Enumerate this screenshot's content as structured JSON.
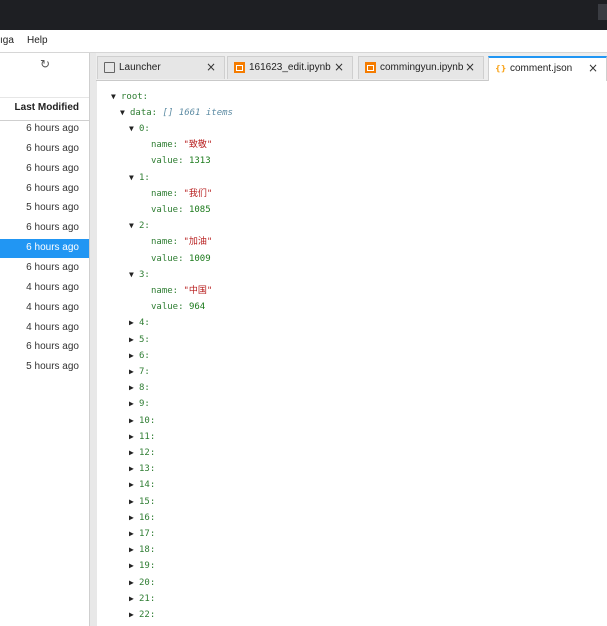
{
  "menu": {
    "items": [
      "ıga",
      "Help"
    ]
  },
  "file_browser": {
    "column_header": "Last Modified",
    "rows": [
      {
        "modified": "6 hours ago",
        "selected": false
      },
      {
        "modified": "6 hours ago",
        "selected": false
      },
      {
        "modified": "6 hours ago",
        "selected": false
      },
      {
        "modified": "6 hours ago",
        "selected": false
      },
      {
        "modified": "5 hours ago",
        "selected": false
      },
      {
        "modified": "6 hours ago",
        "selected": false
      },
      {
        "modified": "6 hours ago",
        "selected": true
      },
      {
        "modified": "6 hours ago",
        "selected": false
      },
      {
        "modified": "4 hours ago",
        "selected": false
      },
      {
        "modified": "4 hours ago",
        "selected": false
      },
      {
        "modified": "4 hours ago",
        "selected": false
      },
      {
        "modified": "6 hours ago",
        "selected": false
      },
      {
        "modified": "5 hours ago",
        "selected": false
      }
    ]
  },
  "tabs": [
    {
      "label": "Launcher",
      "icon": "launcher-icon",
      "active": false
    },
    {
      "label": "161623_edit.ipynb",
      "icon": "notebook-icon",
      "active": false
    },
    {
      "label": "commingyun.ipynb",
      "icon": "notebook-icon",
      "active": false
    },
    {
      "label": "comment.json",
      "icon": "json-icon",
      "active": true
    }
  ],
  "tab_close_glyph": "×",
  "json_viewer": {
    "root_label": "root:",
    "data_label": "data:",
    "data_meta": "[] 1661 items",
    "expanded_items": [
      {
        "index": "0:",
        "name": "\"致敬\"",
        "value": "1313"
      },
      {
        "index": "1:",
        "name": "\"我们\"",
        "value": "1085"
      },
      {
        "index": "2:",
        "name": "\"加油\"",
        "value": "1009"
      },
      {
        "index": "3:",
        "name": "\"中国\"",
        "value": "964"
      }
    ],
    "name_key": "name:",
    "value_key": "value:",
    "collapsed_items": [
      "4:",
      "5:",
      "6:",
      "7:",
      "8:",
      "9:",
      "10:",
      "11:",
      "12:",
      "13:",
      "14:",
      "15:",
      "16:",
      "17:",
      "18:",
      "19:",
      "20:",
      "21:",
      "22:"
    ]
  }
}
